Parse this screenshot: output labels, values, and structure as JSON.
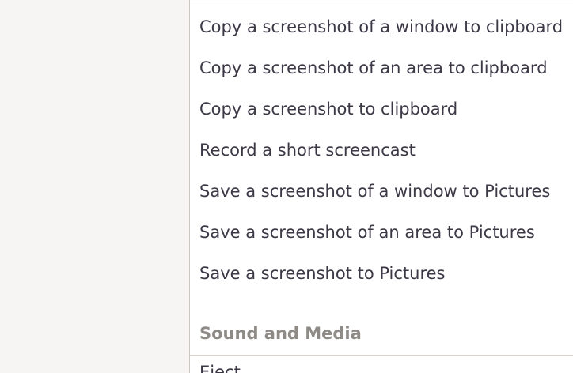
{
  "shortcuts": {
    "items": [
      {
        "label": "Copy a screenshot of a window to clipboard"
      },
      {
        "label": "Copy a screenshot of an area to clipboard"
      },
      {
        "label": "Copy a screenshot to clipboard"
      },
      {
        "label": "Record a short screencast"
      },
      {
        "label": "Save a screenshot of a window to Pictures"
      },
      {
        "label": "Save a screenshot of an area to Pictures"
      },
      {
        "label": "Save a screenshot to Pictures"
      }
    ]
  },
  "sound_section": {
    "title": "Sound and Media",
    "first_item_label": "Eject"
  },
  "colors": {
    "window_background": "#f6f5f4",
    "panel_background": "#ffffff",
    "text": "#3d3846",
    "section_header": "#8e8a86"
  }
}
